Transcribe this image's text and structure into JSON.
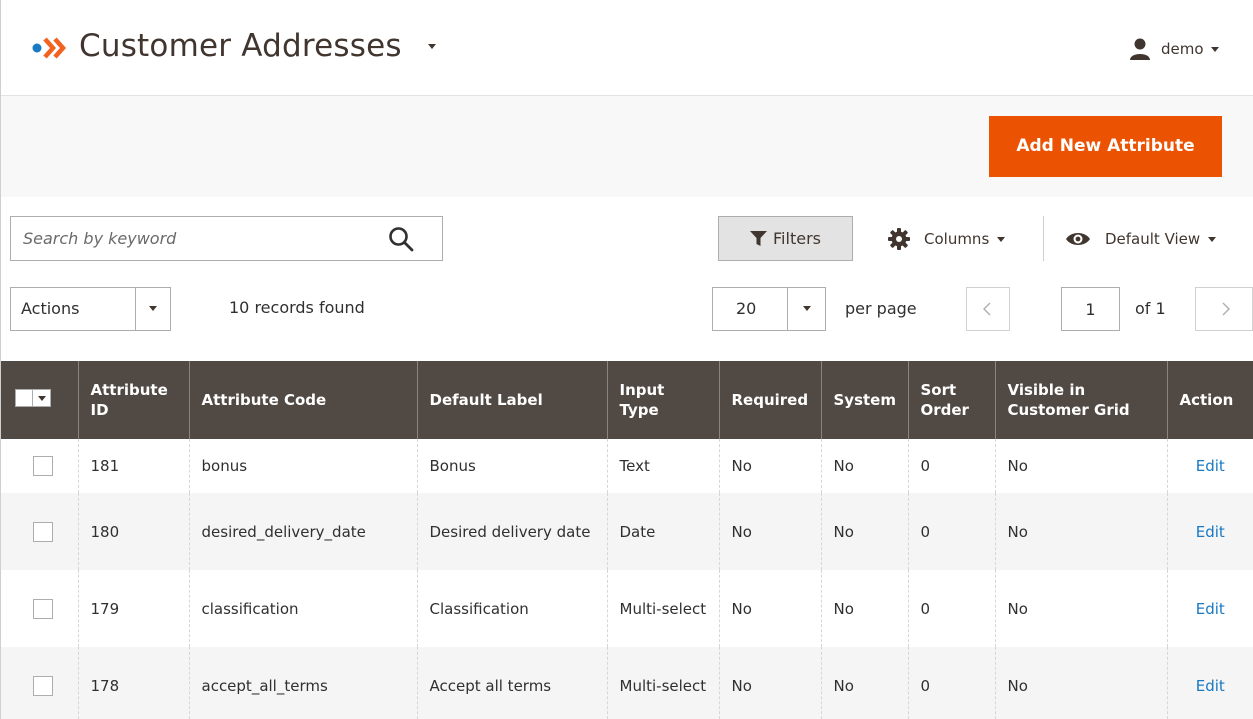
{
  "header": {
    "title": "Customer Addresses",
    "user": "demo"
  },
  "page_actions": {
    "add_button": "Add New Attribute"
  },
  "toolbar": {
    "search_placeholder": "Search by keyword",
    "filters_label": "Filters",
    "columns_label": "Columns",
    "view_label": "Default View",
    "actions_label": "Actions",
    "records_found": "10 records found",
    "per_page_value": "20",
    "per_page_label": "per page",
    "current_page": "1",
    "total_pages_label": "of 1"
  },
  "grid": {
    "columns": [
      "",
      "Attribute ID",
      "Attribute Code",
      "Default Label",
      "Input Type",
      "Required",
      "System",
      "Sort Order",
      "Visible in Customer Grid",
      "Action"
    ],
    "rows": [
      {
        "id": "181",
        "code": "bonus",
        "label": "Bonus",
        "input_type": "Text",
        "required": "No",
        "system": "No",
        "sort_order": "0",
        "visible": "No",
        "action": "Edit"
      },
      {
        "id": "180",
        "code": "desired_delivery_date",
        "label": "Desired delivery date",
        "input_type": "Date",
        "required": "No",
        "system": "No",
        "sort_order": "0",
        "visible": "No",
        "action": "Edit"
      },
      {
        "id": "179",
        "code": "classification",
        "label": "Classification",
        "input_type": "Multi-select",
        "required": "No",
        "system": "No",
        "sort_order": "0",
        "visible": "No",
        "action": "Edit"
      },
      {
        "id": "178",
        "code": "accept_all_terms",
        "label": "Accept all terms",
        "input_type": "Multi-select",
        "required": "No",
        "system": "No",
        "sort_order": "0",
        "visible": "No",
        "action": "Edit"
      }
    ]
  },
  "colors": {
    "accent": "#eb5202",
    "grid_header": "#514943",
    "link": "#1979c3",
    "logo_blue": "#1979c3",
    "logo_orange": "#f26322"
  },
  "icons": {
    "logo": "magento-logo-icon",
    "user": "user-icon",
    "search": "search-icon",
    "filter": "filter-icon",
    "columns": "gear-icon",
    "view": "eye-icon",
    "prev": "chevron-left-icon",
    "next": "chevron-right-icon"
  }
}
